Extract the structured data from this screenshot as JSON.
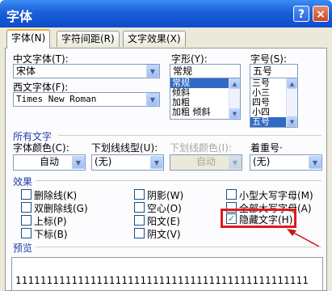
{
  "window": {
    "title": "字体",
    "help_symbol": "?",
    "close_symbol": "×"
  },
  "tabs": [
    "字体(N)",
    "字符间距(R)",
    "文字效果(X)"
  ],
  "labels": {
    "cn_font": "中文字体(T):",
    "west_font": "西文字体(F):",
    "style": "字形(Y):",
    "size": "字号(S):",
    "all_text": "所有文字",
    "font_color": "字体颜色(C):",
    "underline_type": "下划线线型(U):",
    "underline_color": "下划线颜色(I):",
    "emphasis": "着重号·",
    "effects": "效果",
    "preview": "预览"
  },
  "fields": {
    "cn_font": "宋体",
    "west_font": "Times New Roman",
    "style": "常规",
    "size": "五号",
    "font_color": "自动",
    "underline_type": "(无)",
    "underline_color": "自动",
    "emphasis": "(无)"
  },
  "style_list": [
    {
      "text": "常规",
      "selected": true
    },
    {
      "text": "倾斜",
      "selected": false
    },
    {
      "text": "加粗",
      "selected": false
    },
    {
      "text": "加粗 倾斜",
      "selected": false
    }
  ],
  "size_list": [
    {
      "text": "三号",
      "selected": false
    },
    {
      "text": "小三",
      "selected": false
    },
    {
      "text": "四号",
      "selected": false
    },
    {
      "text": "小四",
      "selected": false
    },
    {
      "text": "五号",
      "selected": true
    }
  ],
  "effects": {
    "col1": [
      {
        "label": "删除线(K)",
        "checked": false
      },
      {
        "label": "双删除线(G)",
        "checked": false
      },
      {
        "label": "上标(P)",
        "checked": false
      },
      {
        "label": "下标(B)",
        "checked": false
      }
    ],
    "col2": [
      {
        "label": "阴影(W)",
        "checked": false
      },
      {
        "label": "空心(O)",
        "checked": false
      },
      {
        "label": "阳文(E)",
        "checked": false
      },
      {
        "label": "阴文(V)",
        "checked": false
      }
    ],
    "col3": [
      {
        "label": "小型大写字母(M)",
        "checked": false
      },
      {
        "label": "全部大写字母(A)",
        "checked": false
      },
      {
        "label": "隐藏文字(H)",
        "checked": true
      }
    ]
  },
  "preview_text": "11111111111111111111111111111111111111111111111",
  "colors": {
    "title_bar": "#1a5fd8",
    "highlight": "#e01a1a",
    "selection": "#316ac5"
  },
  "icons": [
    "help-icon",
    "close-icon",
    "dropdown-arrow-icon",
    "checkmark-icon",
    "annotation-arrow-icon"
  ]
}
